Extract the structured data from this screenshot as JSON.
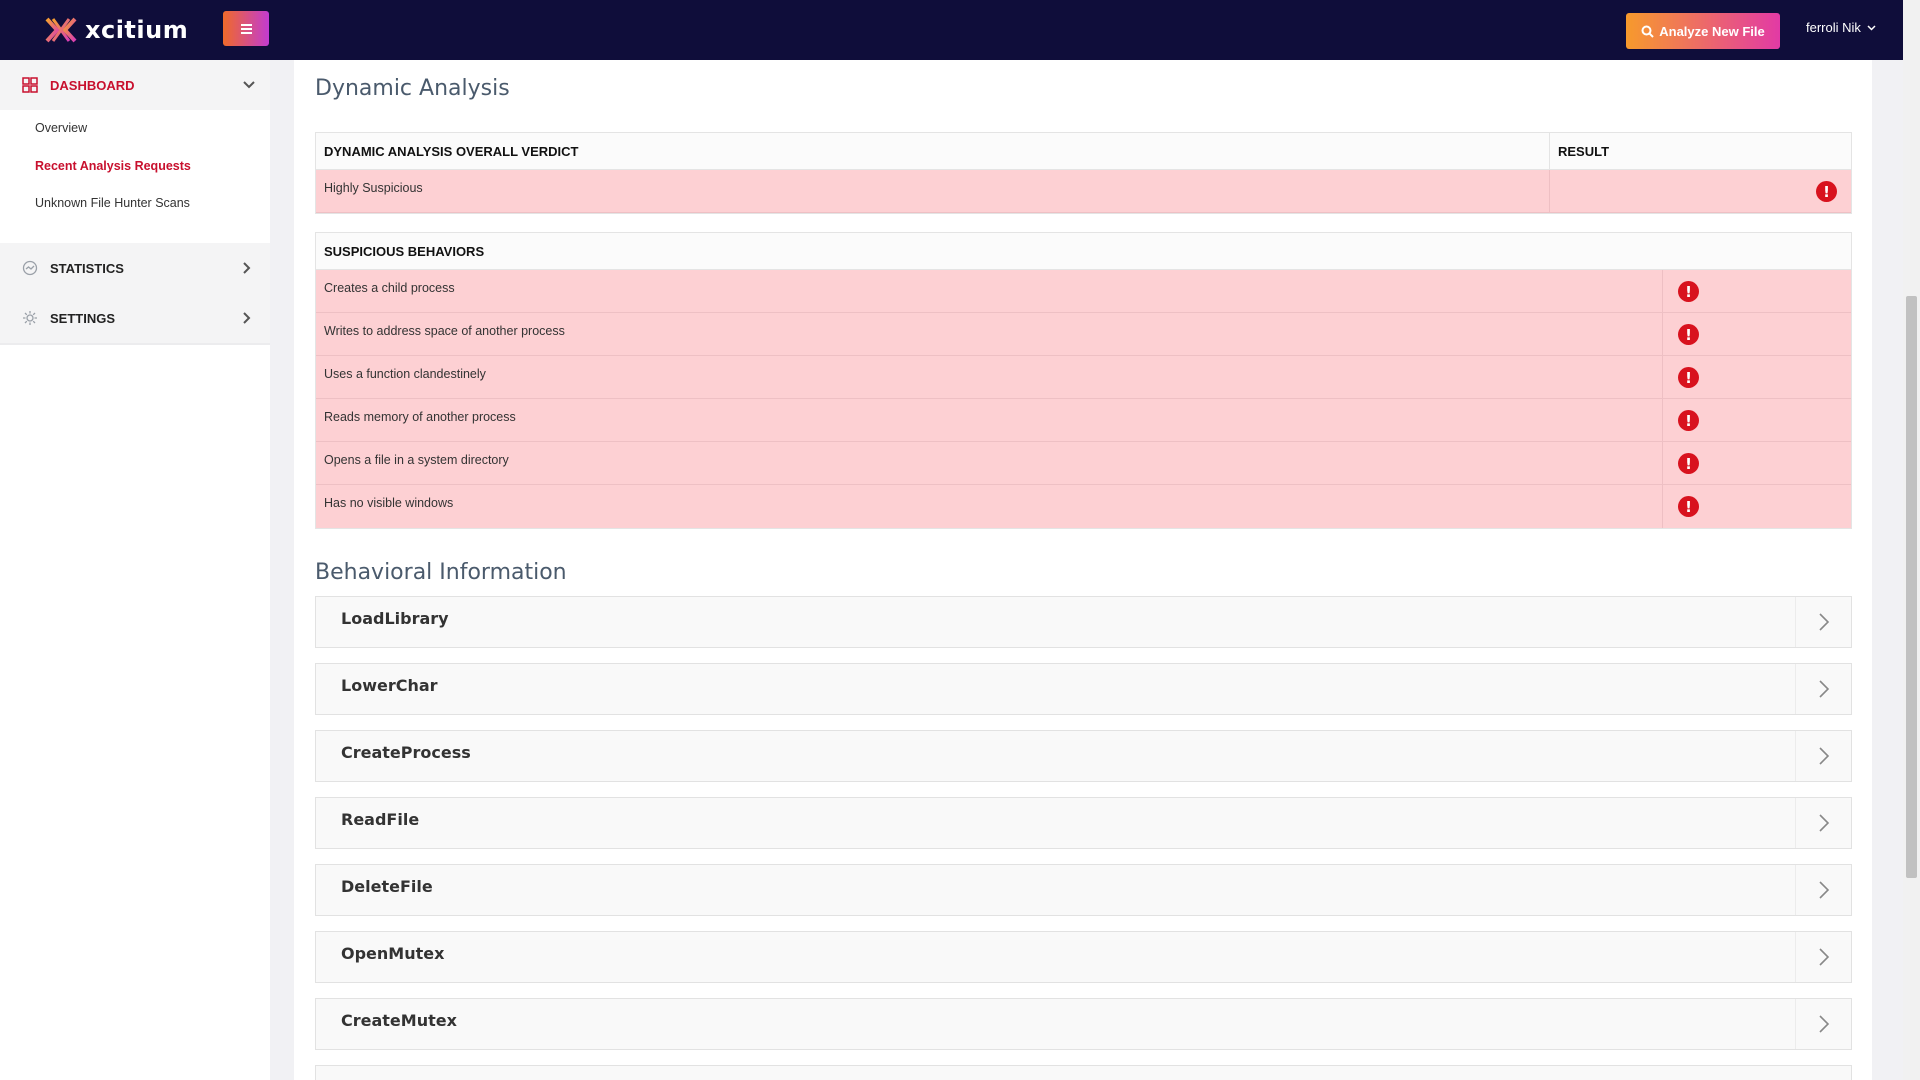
{
  "app": {
    "logo_text": "xcitium",
    "analyze_button": "Analyze New File",
    "user_name": "ferroli Nik"
  },
  "sidebar": {
    "dashboard_label": "DASHBOARD",
    "sub_items": [
      {
        "label": "Overview",
        "active": false
      },
      {
        "label": "Recent Analysis Requests",
        "active": true
      },
      {
        "label": "Unknown File Hunter Scans",
        "active": false
      }
    ],
    "statistics_label": "STATISTICS",
    "settings_label": "SETTINGS"
  },
  "dynamic_analysis": {
    "title": "Dynamic Analysis",
    "verdict_header": "DYNAMIC ANALYSIS OVERALL VERDICT",
    "result_header": "RESULT",
    "verdict_value": "Highly Suspicious",
    "behaviors_header": "SUSPICIOUS BEHAVIORS",
    "behaviors": [
      "Creates a child process",
      "Writes to address space of another process",
      "Uses a function clandestinely",
      "Reads memory of another process",
      "Opens a file in a system directory",
      "Has no visible windows"
    ]
  },
  "behavioral_information": {
    "title": "Behavioral Information",
    "items": [
      "LoadLibrary",
      "LowerChar",
      "CreateProcess",
      "ReadFile",
      "DeleteFile",
      "OpenMutex",
      "CreateMutex"
    ]
  },
  "colors": {
    "topbar": "#0f0d3a",
    "alert_red": "#d8121e",
    "row_pink": "#fdd0d3",
    "active_red": "#c8102e"
  }
}
